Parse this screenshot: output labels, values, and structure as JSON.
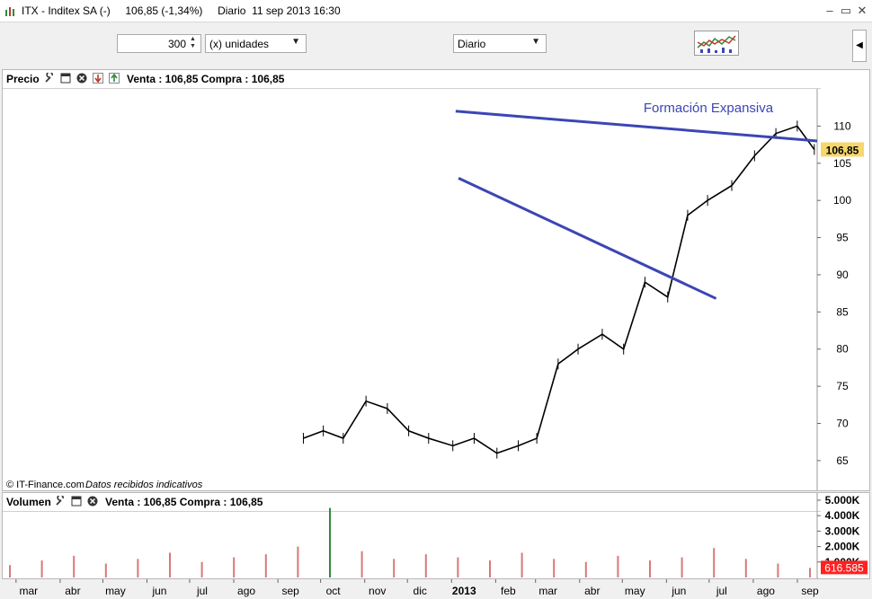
{
  "window": {
    "title": "ITX - Inditex SA (-)     106,85 (-1,34%)     Diario  11 sep 2013 16:30",
    "buttons": [
      "–",
      "▭",
      "✕"
    ]
  },
  "toolbar": {
    "quantity": "300",
    "units": "(x) unidades",
    "period": "Diario"
  },
  "price_panel": {
    "label": "Precio",
    "info": "Venta : 106,85 Compra : 106,85",
    "copyright": "© IT-Finance.com",
    "disclaimer": "Datos recibidos indicativos",
    "last_price_tag": "106,85"
  },
  "volume_panel": {
    "label": "Volumen",
    "info": "Venta : 106,85 Compra : 106,85",
    "last_volume_tag": "616.585"
  },
  "chart_data": {
    "type": "line",
    "title": "",
    "price_axis": {
      "ylim": [
        61,
        115
      ],
      "ticks": [
        65,
        70,
        75,
        80,
        85,
        90,
        95,
        100,
        105,
        110
      ],
      "tick_labels": [
        "65",
        "70",
        "75",
        "80",
        "85",
        "90",
        "95",
        "100",
        "105",
        "110"
      ]
    },
    "volume_axis": {
      "ticks": [
        1000000,
        2000000,
        3000000,
        4000000,
        5000000
      ],
      "tick_labels": [
        "1.000K",
        "2.000K",
        "3.000K",
        "4.000K",
        "5.000K"
      ]
    },
    "x_month_labels": [
      "mar",
      "abr",
      "may",
      "jun",
      "jul",
      "ago",
      "sep",
      "oct",
      "nov",
      "dic",
      "2013",
      "feb",
      "mar",
      "abr",
      "may",
      "jun",
      "jul",
      "ago",
      "sep"
    ],
    "price_series": {
      "x": [
        "2012-09-17",
        "2012-10-01",
        "2012-10-15",
        "2012-10-31",
        "2012-11-15",
        "2012-11-30",
        "2012-12-14",
        "2012-12-31",
        "2013-01-15",
        "2013-01-31",
        "2013-02-15",
        "2013-02-28",
        "2013-03-15",
        "2013-03-29",
        "2013-04-15",
        "2013-04-30",
        "2013-05-15",
        "2013-05-31",
        "2013-06-14",
        "2013-06-28",
        "2013-07-15",
        "2013-07-31",
        "2013-08-15",
        "2013-08-30",
        "2013-09-11"
      ],
      "close": [
        68,
        69,
        68,
        73,
        72,
        69,
        68,
        67,
        68,
        66,
        67,
        68,
        78,
        80,
        82,
        80,
        89,
        87,
        98,
        100,
        102,
        106,
        109,
        110,
        106.85
      ]
    },
    "volume_series": {
      "values": [
        800000,
        1100000,
        1400000,
        900000,
        1200000,
        1600000,
        1000000,
        1300000,
        1500000,
        2000000,
        4500000,
        1700000,
        1200000,
        1500000,
        1300000,
        1100000,
        1600000,
        1200000,
        1000000,
        1400000,
        1100000,
        1300000,
        1900000,
        1200000,
        900000,
        616585
      ]
    },
    "annotations": {
      "label": "Formación Expansiva",
      "upper_line": {
        "x": [
          "2013-01-02",
          "2013-09-13"
        ],
        "y": [
          112.0,
          108.0
        ]
      },
      "lower_line": {
        "x": [
          "2013-01-04",
          "2013-07-04"
        ],
        "y": [
          103.0,
          86.8
        ]
      }
    },
    "colors": {
      "candles": "#000000",
      "trendlines": "#3c46b4",
      "volume_bars": "#d8787a",
      "volume_spike": "#2e8b3a",
      "price_tag": "#f5d76e",
      "volume_tag": "#ff2020"
    }
  }
}
